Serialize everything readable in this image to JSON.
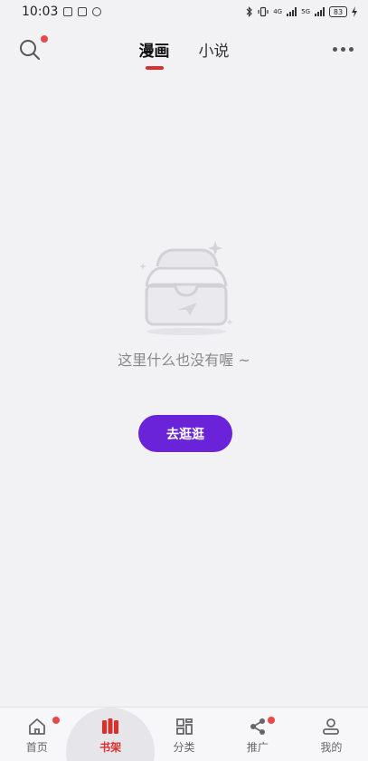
{
  "status_bar": {
    "time": "10:03",
    "battery": "83",
    "network_small": [
      "4G",
      "5G"
    ]
  },
  "topnav": {
    "tabs": [
      {
        "label": "漫画",
        "active": true
      },
      {
        "label": "小说",
        "active": false
      }
    ],
    "search_icon": "search-icon",
    "more_icon": "more-icon"
  },
  "empty_state": {
    "message": "这里什么也没有喔 ~",
    "button_label": "去逛逛",
    "button_color": "#6a23d8"
  },
  "bottom_nav": {
    "items": [
      {
        "label": "首页",
        "icon": "home-icon",
        "badge": true
      },
      {
        "label": "书架",
        "icon": "bookshelf-icon",
        "active": true
      },
      {
        "label": "分类",
        "icon": "category-icon"
      },
      {
        "label": "推广",
        "icon": "share-icon",
        "badge": true
      },
      {
        "label": "我的",
        "icon": "user-icon"
      }
    ]
  },
  "colors": {
    "accent": "#d9302c",
    "badge": "#e94848",
    "background": "#f2f2f5"
  }
}
